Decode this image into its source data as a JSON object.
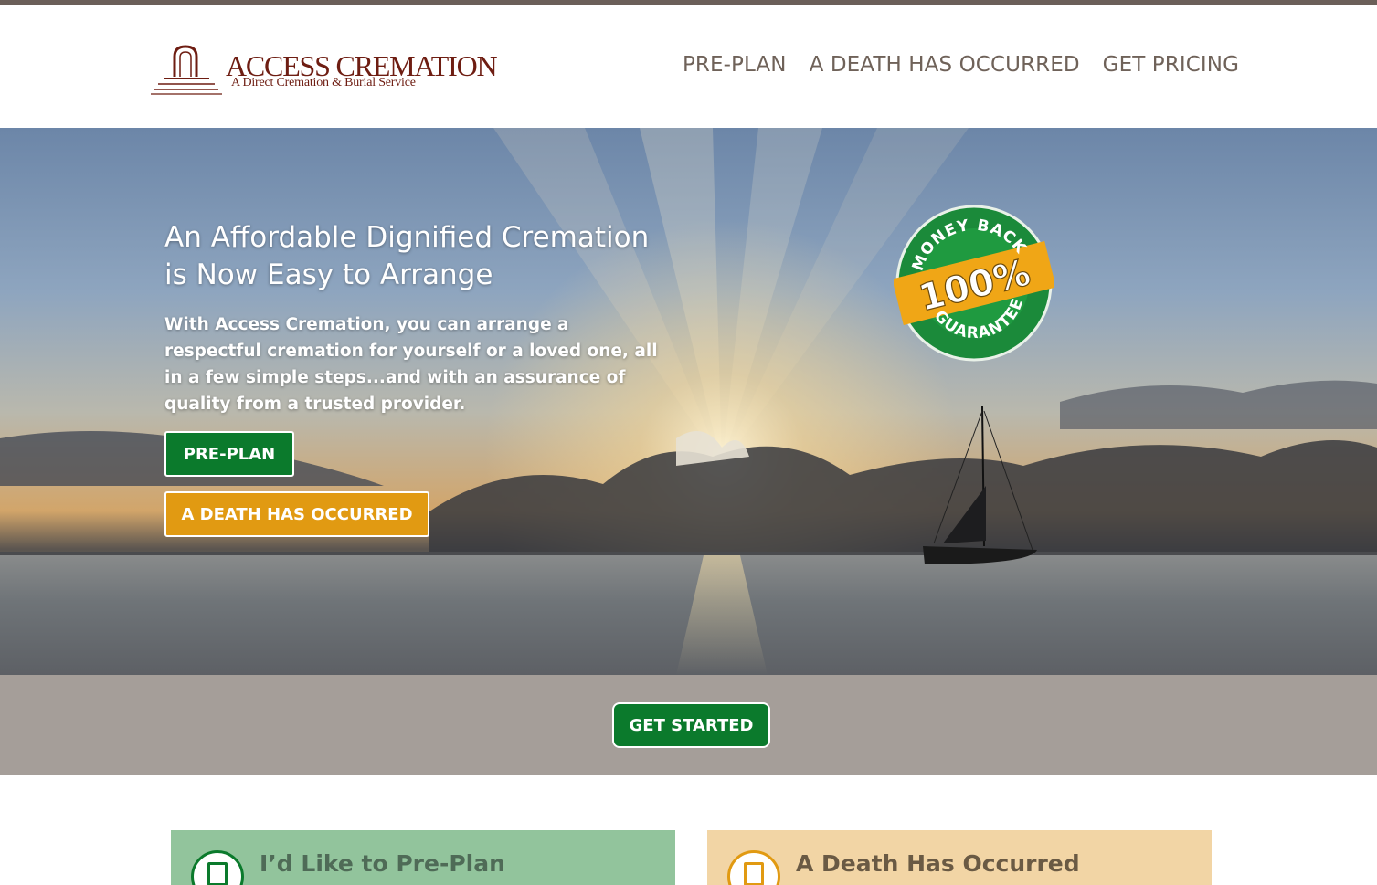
{
  "header": {
    "logo_title": "ACCESS CREMATION",
    "logo_subtitle": "A Direct Cremation & Burial Service",
    "nav": [
      {
        "label": "PRE-PLAN"
      },
      {
        "label": "A DEATH HAS OCCURRED"
      },
      {
        "label": "GET PRICING"
      }
    ]
  },
  "hero": {
    "title": "An Affordable Dignified Cremation is Now Easy to Arrange",
    "text": "With Access Cremation, you can arrange a respectful cremation for yourself or a loved one, all in a few simple steps...and with an assurance of quality from a trusted provider.",
    "btn_preplan": "PRE-PLAN",
    "btn_death": "A DEATH HAS OCCURRED",
    "seal": {
      "top_text": "MONEY BACK",
      "center_text": "100%",
      "bottom_text": "GUARANTEE"
    }
  },
  "band": {
    "btn_start": "GET STARTED"
  },
  "cards": [
    {
      "title": "I’d Like to Pre-Plan",
      "icon": "document-icon"
    },
    {
      "title": "A Death Has Occurred",
      "icon": "document-icon"
    }
  ],
  "colors": {
    "brand": "#6e1d12",
    "green": "#0b7a2c",
    "orange": "#e19a12",
    "band": "#a59e99",
    "nav": "#6f6259"
  }
}
